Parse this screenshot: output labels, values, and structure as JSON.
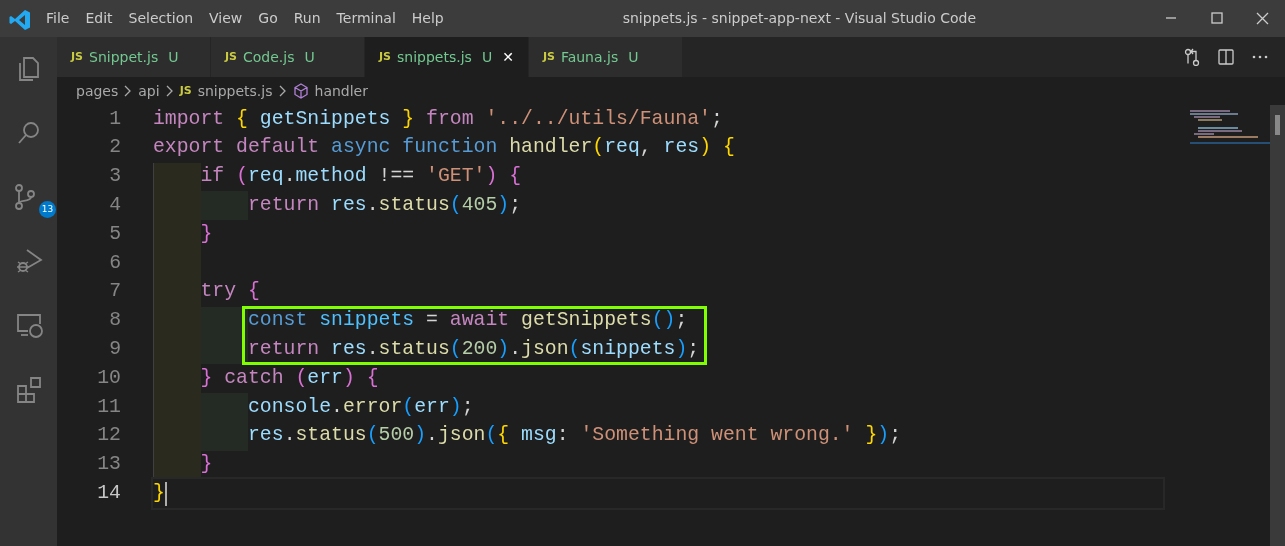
{
  "window": {
    "title": "snippets.js - snippet-app-next - Visual Studio Code"
  },
  "menu": [
    "File",
    "Edit",
    "Selection",
    "View",
    "Go",
    "Run",
    "Terminal",
    "Help"
  ],
  "activity_bar": [
    {
      "kind": "explorer"
    },
    {
      "kind": "search"
    },
    {
      "kind": "source-control",
      "badge": "13"
    },
    {
      "kind": "run"
    },
    {
      "kind": "remote"
    },
    {
      "kind": "extensions"
    }
  ],
  "tabs": [
    {
      "icon": "JS",
      "label": "Snippet.js",
      "status": "U",
      "selected": false
    },
    {
      "icon": "JS",
      "label": "Code.js",
      "status": "U",
      "selected": false
    },
    {
      "icon": "JS",
      "label": "snippets.js",
      "status": "U",
      "selected": true,
      "close": "✕"
    },
    {
      "icon": "JS",
      "label": "Fauna.js",
      "status": "U",
      "selected": false
    }
  ],
  "breadcrumb": [
    {
      "kind": "folder",
      "label": "pages"
    },
    {
      "kind": "folder",
      "label": "api"
    },
    {
      "kind": "file",
      "icon": "JS",
      "label": "snippets.js"
    },
    {
      "kind": "symbol",
      "label": "handler"
    }
  ],
  "editor": {
    "lines": [
      {
        "number": "1",
        "tokens": [
          {
            "text": "import ",
            "kind": "kw"
          },
          {
            "text": "{ ",
            "kind": "b1"
          },
          {
            "text": "getSnippets ",
            "kind": "var"
          },
          {
            "text": "} ",
            "kind": "b1"
          },
          {
            "text": "from ",
            "kind": "kw"
          },
          {
            "text": "'../../utils/Fauna'",
            "kind": "str"
          },
          {
            "text": ";",
            "kind": "p"
          }
        ]
      },
      {
        "number": "2",
        "tokens": [
          {
            "text": "export ",
            "kind": "kw"
          },
          {
            "text": "default ",
            "kind": "kw"
          },
          {
            "text": "async ",
            "kind": "st"
          },
          {
            "text": "function ",
            "kind": "st"
          },
          {
            "text": "handler",
            "kind": "fn"
          },
          {
            "text": "(",
            "kind": "b1"
          },
          {
            "text": "req",
            "kind": "var"
          },
          {
            "text": ", ",
            "kind": "p"
          },
          {
            "text": "res",
            "kind": "var"
          },
          {
            "text": ") ",
            "kind": "b1"
          },
          {
            "text": "{",
            "kind": "b1"
          }
        ]
      },
      {
        "number": "3",
        "tokens": [
          {
            "kind": "indent"
          },
          {
            "text": "if ",
            "kind": "kw"
          },
          {
            "text": "(",
            "kind": "b2"
          },
          {
            "text": "req",
            "kind": "var"
          },
          {
            "text": ".",
            "kind": "p"
          },
          {
            "text": "method",
            "kind": "var"
          },
          {
            "text": " !== ",
            "kind": "p"
          },
          {
            "text": "'GET'",
            "kind": "str"
          },
          {
            "text": ") ",
            "kind": "b2"
          },
          {
            "text": "{",
            "kind": "b2"
          }
        ]
      },
      {
        "number": "4",
        "tokens": [
          {
            "kind": "indent"
          },
          {
            "kind": "indent"
          },
          {
            "text": "return ",
            "kind": "kw"
          },
          {
            "text": "res",
            "kind": "var"
          },
          {
            "text": ".",
            "kind": "p"
          },
          {
            "text": "status",
            "kind": "fn"
          },
          {
            "text": "(",
            "kind": "b3"
          },
          {
            "text": "405",
            "kind": "num"
          },
          {
            "text": ")",
            "kind": "b3"
          },
          {
            "text": ";",
            "kind": "p"
          }
        ]
      },
      {
        "number": "5",
        "tokens": [
          {
            "kind": "indent"
          },
          {
            "text": "}",
            "kind": "b2"
          }
        ]
      },
      {
        "number": "6",
        "tokens": [
          {
            "kind": "indent"
          }
        ]
      },
      {
        "number": "7",
        "tokens": [
          {
            "kind": "indent"
          },
          {
            "text": "try ",
            "kind": "kw"
          },
          {
            "text": "{",
            "kind": "b2"
          }
        ]
      },
      {
        "number": "8",
        "boxed": true,
        "tokens": [
          {
            "kind": "indent"
          },
          {
            "kind": "indent"
          },
          {
            "text": "const ",
            "kind": "st"
          },
          {
            "text": "snippets ",
            "kind": "cvar"
          },
          {
            "text": "= ",
            "kind": "p"
          },
          {
            "text": "await ",
            "kind": "kw"
          },
          {
            "text": "getSnippets",
            "kind": "fn"
          },
          {
            "text": "()",
            "kind": "b3"
          },
          {
            "text": ";",
            "kind": "p"
          }
        ]
      },
      {
        "number": "9",
        "boxed": true,
        "tokens": [
          {
            "kind": "indent"
          },
          {
            "kind": "indent"
          },
          {
            "text": "return ",
            "kind": "kw"
          },
          {
            "text": "res",
            "kind": "var"
          },
          {
            "text": ".",
            "kind": "p"
          },
          {
            "text": "status",
            "kind": "fn"
          },
          {
            "text": "(",
            "kind": "b3"
          },
          {
            "text": "200",
            "kind": "num"
          },
          {
            "text": ")",
            "kind": "b3"
          },
          {
            "text": ".",
            "kind": "p"
          },
          {
            "text": "json",
            "kind": "fn"
          },
          {
            "text": "(",
            "kind": "b3"
          },
          {
            "text": "snippets",
            "kind": "var"
          },
          {
            "text": ")",
            "kind": "b3"
          },
          {
            "text": ";",
            "kind": "p"
          }
        ]
      },
      {
        "number": "10",
        "tokens": [
          {
            "kind": "indent"
          },
          {
            "text": "} ",
            "kind": "b2"
          },
          {
            "text": "catch ",
            "kind": "kw"
          },
          {
            "text": "(",
            "kind": "b2"
          },
          {
            "text": "err",
            "kind": "var"
          },
          {
            "text": ") ",
            "kind": "b2"
          },
          {
            "text": "{",
            "kind": "b2"
          }
        ]
      },
      {
        "number": "11",
        "tokens": [
          {
            "kind": "indent"
          },
          {
            "kind": "indent"
          },
          {
            "text": "console",
            "kind": "var"
          },
          {
            "text": ".",
            "kind": "p"
          },
          {
            "text": "error",
            "kind": "fn"
          },
          {
            "text": "(",
            "kind": "b3"
          },
          {
            "text": "err",
            "kind": "var"
          },
          {
            "text": ")",
            "kind": "b3"
          },
          {
            "text": ";",
            "kind": "p"
          }
        ]
      },
      {
        "number": "12",
        "tokens": [
          {
            "kind": "indent"
          },
          {
            "kind": "indent"
          },
          {
            "text": "res",
            "kind": "var"
          },
          {
            "text": ".",
            "kind": "p"
          },
          {
            "text": "status",
            "kind": "fn"
          },
          {
            "text": "(",
            "kind": "b3"
          },
          {
            "text": "500",
            "kind": "num"
          },
          {
            "text": ")",
            "kind": "b3"
          },
          {
            "text": ".",
            "kind": "p"
          },
          {
            "text": "json",
            "kind": "fn"
          },
          {
            "text": "(",
            "kind": "b3"
          },
          {
            "text": "{ ",
            "kind": "b1"
          },
          {
            "text": "msg",
            "kind": "var"
          },
          {
            "text": ": ",
            "kind": "p"
          },
          {
            "text": "'Something went wrong.' ",
            "kind": "str"
          },
          {
            "text": "}",
            "kind": "b1"
          },
          {
            "text": ")",
            "kind": "b3"
          },
          {
            "text": ";",
            "kind": "p"
          }
        ]
      },
      {
        "number": "13",
        "tokens": [
          {
            "kind": "indent"
          },
          {
            "text": "}",
            "kind": "b2"
          }
        ]
      },
      {
        "number": "14",
        "current": true,
        "tokens": [
          {
            "text": "}",
            "kind": "b1"
          }
        ]
      }
    ]
  }
}
